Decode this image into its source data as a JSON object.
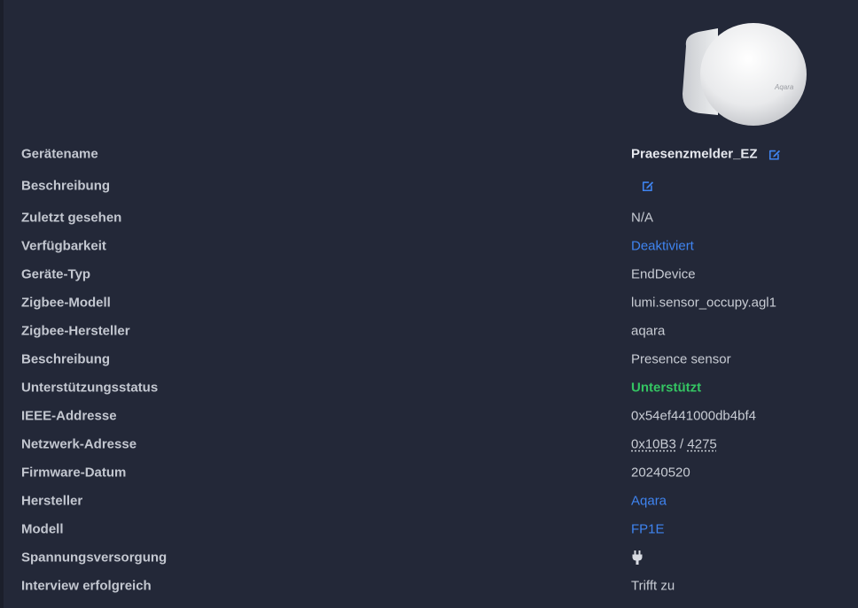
{
  "device": {
    "image_alt": "Aqara",
    "rows": [
      {
        "label": "Gerätename",
        "value": "Praesenzmelder_EZ"
      },
      {
        "label": "Beschreibung",
        "value": ""
      },
      {
        "label": "Zuletzt gesehen",
        "value": "N/A"
      },
      {
        "label": "Verfügbarkeit",
        "value": "Deaktiviert"
      },
      {
        "label": "Geräte-Typ",
        "value": "EndDevice"
      },
      {
        "label": "Zigbee-Modell",
        "value": "lumi.sensor_occupy.agl1"
      },
      {
        "label": "Zigbee-Hersteller",
        "value": "aqara"
      },
      {
        "label": "Beschreibung",
        "value": "Presence sensor"
      },
      {
        "label": "Unterstützungsstatus",
        "value": "Unterstützt"
      },
      {
        "label": "IEEE-Addresse",
        "value": "0x54ef441000db4bf4"
      },
      {
        "label": "Netzwerk-Adresse",
        "value_hex": "0x10B3",
        "separator": " / ",
        "value_dec": "4275"
      },
      {
        "label": "Firmware-Datum",
        "value": "20240520"
      },
      {
        "label": "Hersteller",
        "value": "Aqara"
      },
      {
        "label": "Modell",
        "value": "FP1E"
      },
      {
        "label": "Spannungsversorgung",
        "value": "",
        "icon": "plug-icon"
      },
      {
        "label": "Interview erfolgreich",
        "value": "Trifft zu"
      }
    ]
  },
  "colors": {
    "background": "#232838",
    "label": "#c3c7d0",
    "value": "#c8ccd4",
    "link": "#3f84f0",
    "success": "#34c462"
  }
}
